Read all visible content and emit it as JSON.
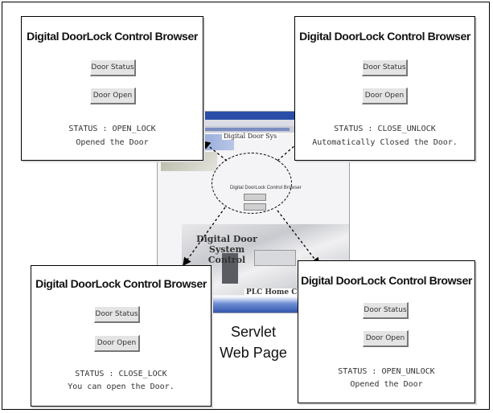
{
  "panels": {
    "top_left": {
      "title": "Digital DoorLock Control Browser",
      "status_button": "Door Status",
      "open_button": "Door Open",
      "status_line": "STATUS : OPEN_LOCK",
      "message": "Opened the Door"
    },
    "top_right": {
      "title": "Digital DoorLock Control Browser",
      "status_button": "Door Status",
      "open_button": "Door Open",
      "status_line": "STATUS : CLOSE_UNLOCK",
      "message": "Automatically Closed the Door."
    },
    "bottom_left": {
      "title": "Digital DoorLock Control Browser",
      "status_button": "Door Status",
      "open_button": "Door Open",
      "status_line": "STATUS : CLOSE_LOCK",
      "message": "You can open the Door."
    },
    "bottom_right": {
      "title": "Digital DoorLock Control Browser",
      "status_button": "Door Status",
      "open_button": "Door Open",
      "status_line": "STATUS : OPEN_UNLOCK",
      "message": "Opened the Door"
    }
  },
  "center_screenshot": {
    "top_label": "Digital Door Sys",
    "mini_title": "Digital DoorLock Control Browser",
    "overlay_line1": "Digital Door System",
    "overlay_line2": "Control",
    "plc_label": "PLC Home Co"
  },
  "caption": {
    "line1": "Servlet",
    "line2": "Web Page"
  }
}
